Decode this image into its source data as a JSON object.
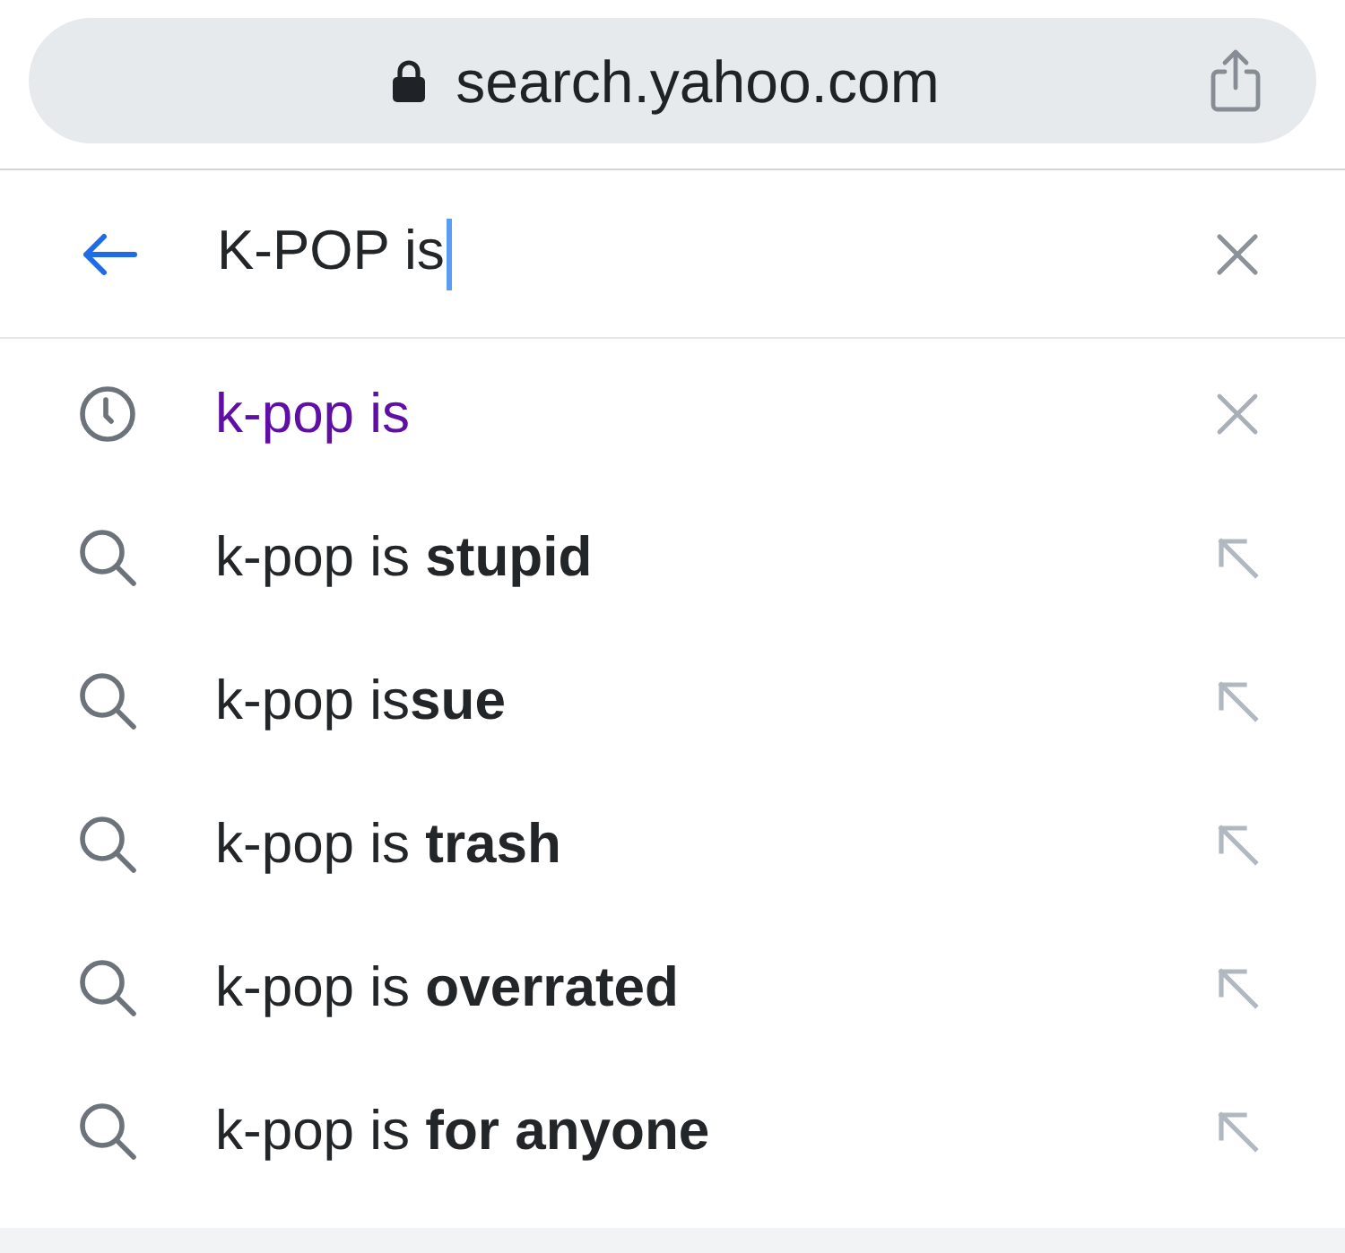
{
  "address_bar": {
    "url": "search.yahoo.com"
  },
  "search": {
    "value": "K-POP is",
    "focused": true
  },
  "suggestions": [
    {
      "kind": "history",
      "text": "k-pop is"
    },
    {
      "kind": "suggestion",
      "text": "k-pop is **stupid**"
    },
    {
      "kind": "suggestion",
      "text": "k-pop is**sue**"
    },
    {
      "kind": "suggestion",
      "text": "k-pop is **trash**"
    },
    {
      "kind": "suggestion",
      "text": "k-pop is **overrated**"
    },
    {
      "kind": "suggestion",
      "text": "k-pop is **for anyone**"
    }
  ]
}
